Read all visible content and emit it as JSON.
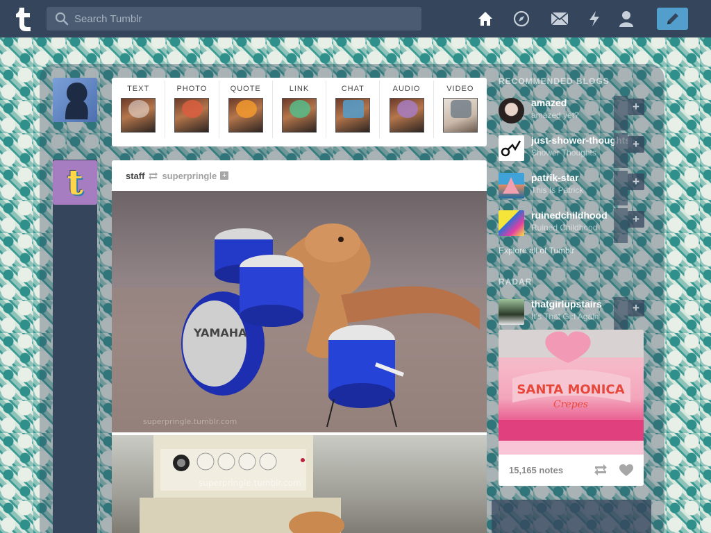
{
  "header": {
    "search_placeholder": "Search Tumblr",
    "nav": [
      "home-icon",
      "explore-icon",
      "inbox-icon",
      "activity-icon",
      "account-icon"
    ],
    "compose": "pencil-icon"
  },
  "post_types": [
    {
      "label": "TEXT",
      "color": "#ffffff"
    },
    {
      "label": "PHOTO",
      "color": "#d95e40"
    },
    {
      "label": "QUOTE",
      "color": "#f2992e"
    },
    {
      "label": "LINK",
      "color": "#56bc8a"
    },
    {
      "label": "CHAT",
      "color": "#529ecc"
    },
    {
      "label": "AUDIO",
      "color": "#a77dc2"
    },
    {
      "label": "VIDEO",
      "color": "#748089"
    }
  ],
  "post": {
    "author": "staff",
    "source": "superpringle",
    "watermark1": "superpringle.tumblr.com",
    "watermark2": "superpringle.tumblr.com"
  },
  "sidebar": {
    "recommended_title": "RECOMMENDED BLOGS",
    "blogs": [
      {
        "name": "amazed",
        "subtitle": "amazed yet?"
      },
      {
        "name": "just-shower-thoughts",
        "subtitle": "Shower Thoughts"
      },
      {
        "name": "patrik-star",
        "subtitle": "This Is Patrick"
      },
      {
        "name": "ruinedchildhood",
        "subtitle": "Ruined Childhood"
      }
    ],
    "explore_link": "Explore all of Tumblr",
    "radar_title": "RADAR",
    "radar": {
      "name": "thatgirlupstairs",
      "subtitle": "It's That Girl Again",
      "notes": "15,165 notes",
      "sign_text": "SANTA MONICA",
      "sign_sub": "Crepes"
    }
  }
}
